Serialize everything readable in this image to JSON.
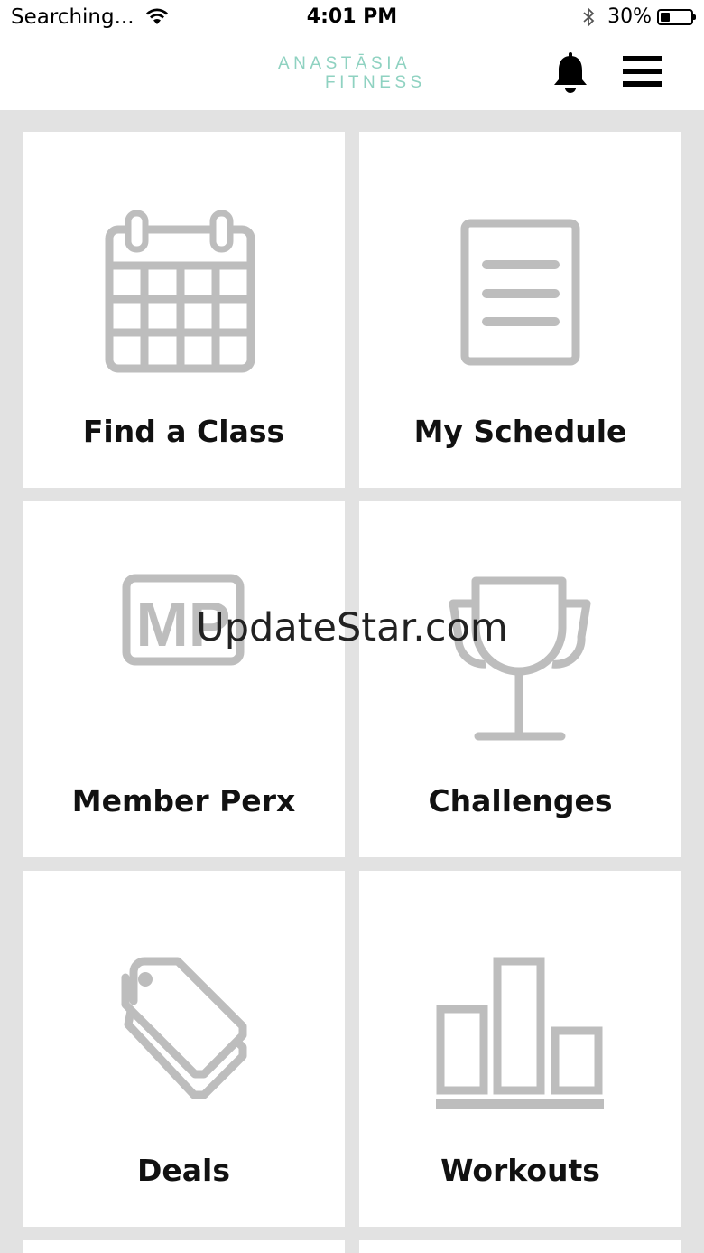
{
  "status": {
    "carrier": "Searching...",
    "time": "4:01 PM",
    "battery": "30%",
    "battery_level": 0.3
  },
  "header": {
    "logo_line1": "ANASTĀSIA",
    "logo_line2": "FITNESS"
  },
  "tiles": [
    {
      "label": "Find a Class",
      "icon": "calendar-icon"
    },
    {
      "label": "My Schedule",
      "icon": "document-icon"
    },
    {
      "label": "Member Perx",
      "icon": "mp-badge-icon",
      "icon_text": "MP"
    },
    {
      "label": "Challenges",
      "icon": "trophy-icon"
    },
    {
      "label": "Deals",
      "icon": "tag-icon"
    },
    {
      "label": "Workouts",
      "icon": "bar-chart-icon"
    }
  ],
  "watermark": "UpdateStar.com",
  "colors": {
    "background": "#e2e2e2",
    "tile": "#ffffff",
    "icon_gray": "#bdbdbd",
    "logo": "#8fd2c1"
  }
}
